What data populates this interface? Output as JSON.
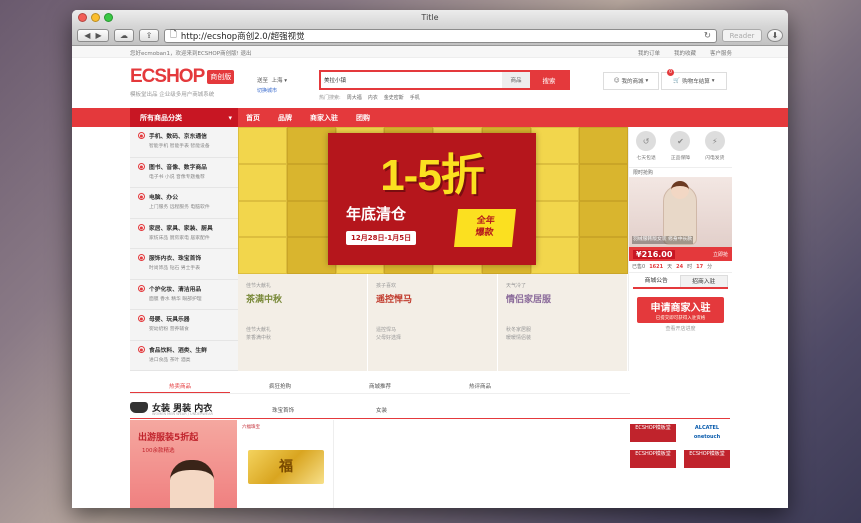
{
  "window": {
    "title": "Title"
  },
  "browser": {
    "url": "http://ecshop商创2.0/超强视觉",
    "reader": "Reader"
  },
  "topbar": {
    "welcome": "您好ecmoban1，欢迎来到ECSHOP商创版! 退出",
    "links": [
      "我的订单",
      "我的收藏",
      "客户服务"
    ]
  },
  "header": {
    "logo": "ECSHOP",
    "logo_badge": "商创版",
    "slogan": "模板堂出品  企业级多用户商城系统",
    "loc_label": "送至",
    "loc_city": "上海",
    "loc_switch": "切换城市",
    "search_value": "美拉小镇",
    "search_cat": "商品",
    "search_button": "搜索",
    "hot_label": "热门搜索:",
    "hot": [
      "周大福",
      "内衣",
      "金史密斯",
      "手机"
    ],
    "myshop": "我的商城",
    "cart": "购物车结算",
    "cart_count": "0"
  },
  "nav": {
    "allcat": "所有商品分类",
    "items": [
      "首页",
      "品牌",
      "商家入驻",
      "团购"
    ]
  },
  "categories": [
    {
      "title": "手机、数码、京东通信",
      "sub": "智能手机  智能手表  智能设备"
    },
    {
      "title": "图书、音像、数字商品",
      "sub": "电子书  小说  音像专题推荐"
    },
    {
      "title": "电脑、办公",
      "sub": "上门服务  远程服务  电脑软件"
    },
    {
      "title": "家居、家具、家装、厨具",
      "sub": "家纺床品  厨房家电  居家配件"
    },
    {
      "title": "服饰内衣、珠宝首饰",
      "sub": "时尚饰品  钻石  男士手表"
    },
    {
      "title": "个护化妆、清洁用品",
      "sub": "面膜  香水  精华  眼部护理"
    },
    {
      "title": "母婴、玩具乐器",
      "sub": "婴幼奶粉  营养辅食"
    },
    {
      "title": "食品饮料、酒类、生鲜",
      "sub": "进口食品  茶叶  酒类"
    }
  ],
  "banner": {
    "big": "1-5折",
    "sub": "年底清仓",
    "date": "12月28日-1月5日",
    "year_tag1": "全年",
    "year_tag2": "爆款"
  },
  "subbanners": [
    {
      "small": "佳节大献礼",
      "large": "茶满中秋",
      "text1": "佳节大献礼",
      "text2": "茶香满中秋"
    },
    {
      "small": "孩子喜欢",
      "large": "遥控悍马",
      "text1": "遥控悍马",
      "text2": "父母好选择"
    },
    {
      "small": "天气冷了",
      "large": "情侣家居服",
      "text1": "秋冬家居服",
      "text2": "暖暖情侣装"
    }
  ],
  "services": [
    "七天包退",
    "正品保障",
    "闪电发货"
  ],
  "flash": {
    "label": "限时抢购",
    "caption": "羽绒服韩版女装 修身中长款",
    "price": "¥216.00",
    "buy": "立即抢",
    "timer_label": "已售0",
    "days": "1621",
    "hours": "24",
    "mins": "17"
  },
  "notice": {
    "tab1": "商城公告",
    "tab2": "招商入驻",
    "apply": "申请商家入驻",
    "apply_sub": "已提交即可获得入驻资格",
    "progress": "查看开店进度"
  },
  "hottabs": [
    "热卖商品",
    "疯狂抢购",
    "商城推荐",
    "热评商品"
  ],
  "floor": {
    "title": "女装 男装 内衣",
    "subtitle": "WOMEN MEN WEAR / UNDERWEAR",
    "tabs": [
      "珠宝首饰",
      "女装"
    ]
  },
  "floorimg": {
    "line1": "出游服装5折起",
    "line2": "100余款精选",
    "gold_tag": "六福珠宝",
    "gold": "福"
  },
  "ads": [
    "ECSHOP模板堂",
    "ALCATEL onetouch",
    "ECSHOP模板堂",
    "ECSHOP模板堂"
  ]
}
